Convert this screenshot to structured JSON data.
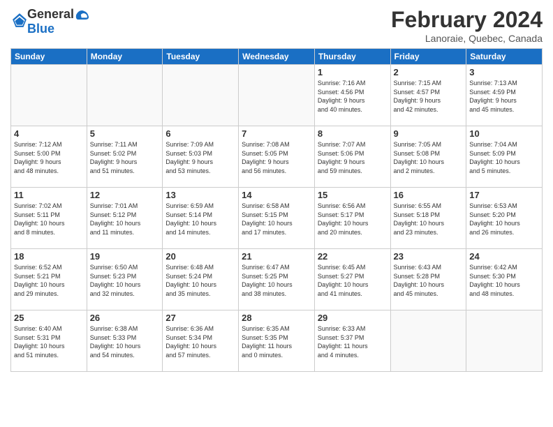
{
  "header": {
    "logo": {
      "general": "General",
      "blue": "Blue"
    },
    "title": "February 2024",
    "location": "Lanoraie, Quebec, Canada"
  },
  "weekdays": [
    "Sunday",
    "Monday",
    "Tuesday",
    "Wednesday",
    "Thursday",
    "Friday",
    "Saturday"
  ],
  "weeks": [
    [
      {
        "day": "",
        "info": ""
      },
      {
        "day": "",
        "info": ""
      },
      {
        "day": "",
        "info": ""
      },
      {
        "day": "",
        "info": ""
      },
      {
        "day": "1",
        "info": "Sunrise: 7:16 AM\nSunset: 4:56 PM\nDaylight: 9 hours\nand 40 minutes."
      },
      {
        "day": "2",
        "info": "Sunrise: 7:15 AM\nSunset: 4:57 PM\nDaylight: 9 hours\nand 42 minutes."
      },
      {
        "day": "3",
        "info": "Sunrise: 7:13 AM\nSunset: 4:59 PM\nDaylight: 9 hours\nand 45 minutes."
      }
    ],
    [
      {
        "day": "4",
        "info": "Sunrise: 7:12 AM\nSunset: 5:00 PM\nDaylight: 9 hours\nand 48 minutes."
      },
      {
        "day": "5",
        "info": "Sunrise: 7:11 AM\nSunset: 5:02 PM\nDaylight: 9 hours\nand 51 minutes."
      },
      {
        "day": "6",
        "info": "Sunrise: 7:09 AM\nSunset: 5:03 PM\nDaylight: 9 hours\nand 53 minutes."
      },
      {
        "day": "7",
        "info": "Sunrise: 7:08 AM\nSunset: 5:05 PM\nDaylight: 9 hours\nand 56 minutes."
      },
      {
        "day": "8",
        "info": "Sunrise: 7:07 AM\nSunset: 5:06 PM\nDaylight: 9 hours\nand 59 minutes."
      },
      {
        "day": "9",
        "info": "Sunrise: 7:05 AM\nSunset: 5:08 PM\nDaylight: 10 hours\nand 2 minutes."
      },
      {
        "day": "10",
        "info": "Sunrise: 7:04 AM\nSunset: 5:09 PM\nDaylight: 10 hours\nand 5 minutes."
      }
    ],
    [
      {
        "day": "11",
        "info": "Sunrise: 7:02 AM\nSunset: 5:11 PM\nDaylight: 10 hours\nand 8 minutes."
      },
      {
        "day": "12",
        "info": "Sunrise: 7:01 AM\nSunset: 5:12 PM\nDaylight: 10 hours\nand 11 minutes."
      },
      {
        "day": "13",
        "info": "Sunrise: 6:59 AM\nSunset: 5:14 PM\nDaylight: 10 hours\nand 14 minutes."
      },
      {
        "day": "14",
        "info": "Sunrise: 6:58 AM\nSunset: 5:15 PM\nDaylight: 10 hours\nand 17 minutes."
      },
      {
        "day": "15",
        "info": "Sunrise: 6:56 AM\nSunset: 5:17 PM\nDaylight: 10 hours\nand 20 minutes."
      },
      {
        "day": "16",
        "info": "Sunrise: 6:55 AM\nSunset: 5:18 PM\nDaylight: 10 hours\nand 23 minutes."
      },
      {
        "day": "17",
        "info": "Sunrise: 6:53 AM\nSunset: 5:20 PM\nDaylight: 10 hours\nand 26 minutes."
      }
    ],
    [
      {
        "day": "18",
        "info": "Sunrise: 6:52 AM\nSunset: 5:21 PM\nDaylight: 10 hours\nand 29 minutes."
      },
      {
        "day": "19",
        "info": "Sunrise: 6:50 AM\nSunset: 5:23 PM\nDaylight: 10 hours\nand 32 minutes."
      },
      {
        "day": "20",
        "info": "Sunrise: 6:48 AM\nSunset: 5:24 PM\nDaylight: 10 hours\nand 35 minutes."
      },
      {
        "day": "21",
        "info": "Sunrise: 6:47 AM\nSunset: 5:25 PM\nDaylight: 10 hours\nand 38 minutes."
      },
      {
        "day": "22",
        "info": "Sunrise: 6:45 AM\nSunset: 5:27 PM\nDaylight: 10 hours\nand 41 minutes."
      },
      {
        "day": "23",
        "info": "Sunrise: 6:43 AM\nSunset: 5:28 PM\nDaylight: 10 hours\nand 45 minutes."
      },
      {
        "day": "24",
        "info": "Sunrise: 6:42 AM\nSunset: 5:30 PM\nDaylight: 10 hours\nand 48 minutes."
      }
    ],
    [
      {
        "day": "25",
        "info": "Sunrise: 6:40 AM\nSunset: 5:31 PM\nDaylight: 10 hours\nand 51 minutes."
      },
      {
        "day": "26",
        "info": "Sunrise: 6:38 AM\nSunset: 5:33 PM\nDaylight: 10 hours\nand 54 minutes."
      },
      {
        "day": "27",
        "info": "Sunrise: 6:36 AM\nSunset: 5:34 PM\nDaylight: 10 hours\nand 57 minutes."
      },
      {
        "day": "28",
        "info": "Sunrise: 6:35 AM\nSunset: 5:35 PM\nDaylight: 11 hours\nand 0 minutes."
      },
      {
        "day": "29",
        "info": "Sunrise: 6:33 AM\nSunset: 5:37 PM\nDaylight: 11 hours\nand 4 minutes."
      },
      {
        "day": "",
        "info": ""
      },
      {
        "day": "",
        "info": ""
      }
    ]
  ]
}
